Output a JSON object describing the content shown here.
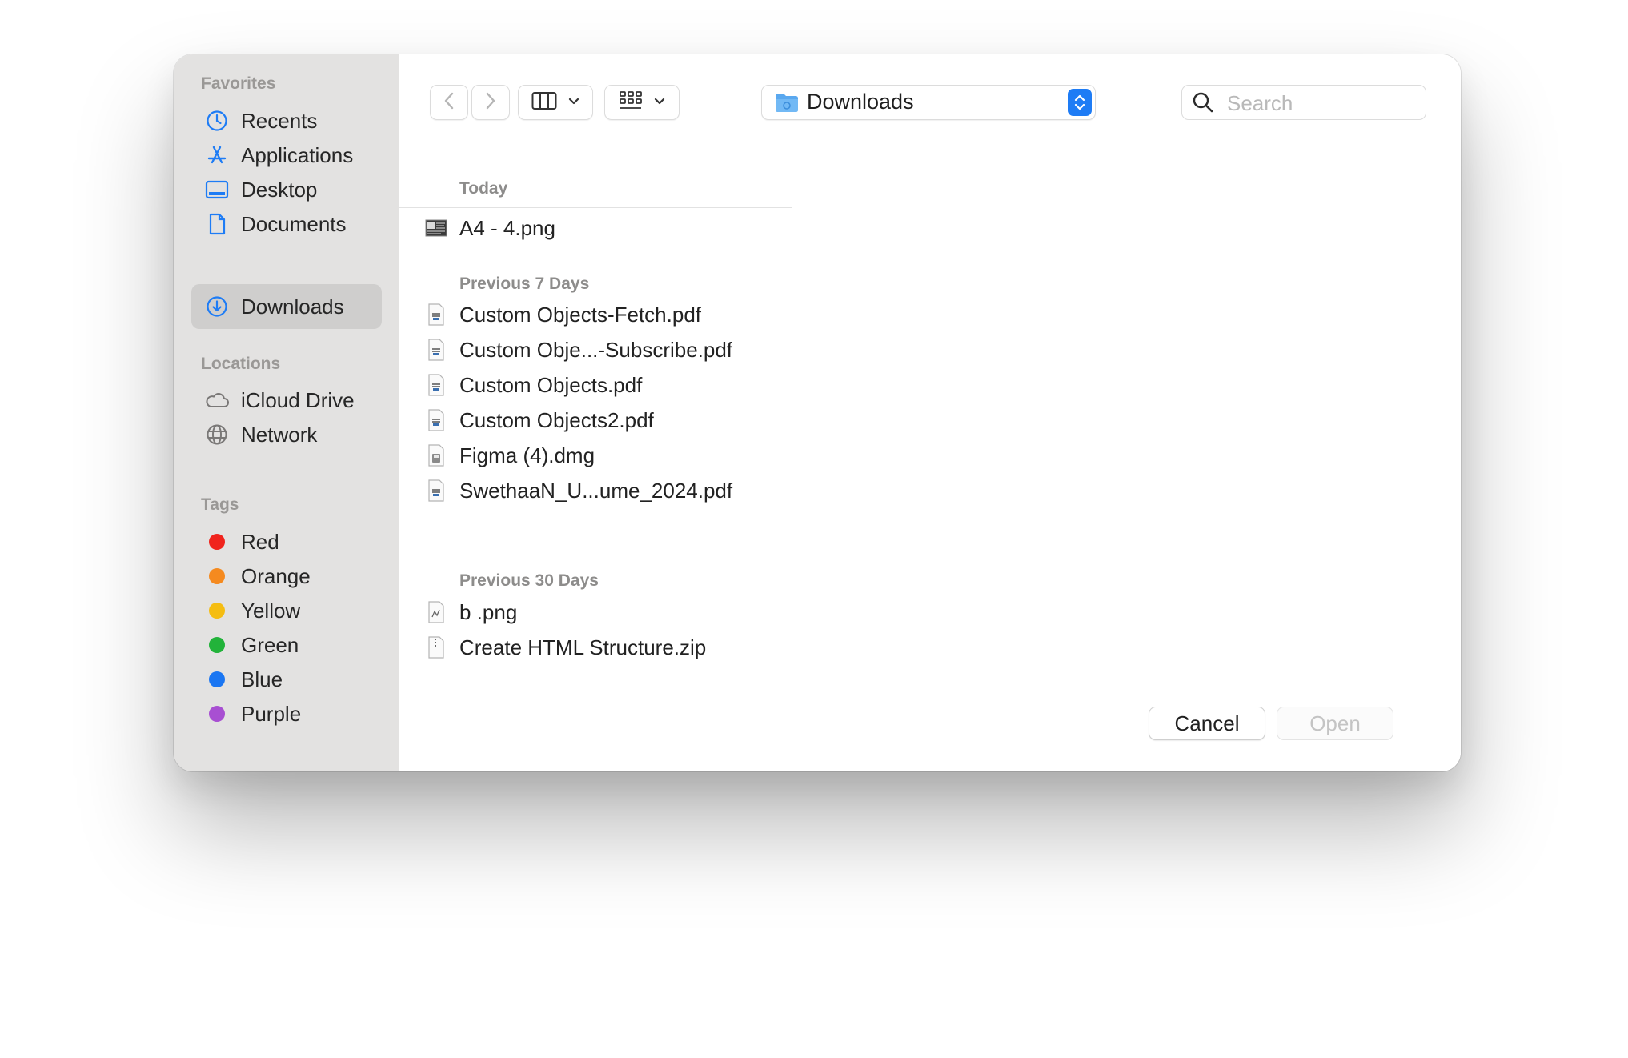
{
  "sidebar": {
    "favorites_header": "Favorites",
    "favorites": [
      {
        "label": "Recents",
        "icon": "clock-icon"
      },
      {
        "label": "Applications",
        "icon": "app-store-icon"
      },
      {
        "label": "Desktop",
        "icon": "desktop-icon"
      },
      {
        "label": "Documents",
        "icon": "document-icon"
      },
      {
        "label": "Downloads",
        "icon": "download-icon",
        "selected": true
      }
    ],
    "locations_header": "Locations",
    "locations": [
      {
        "label": "iCloud Drive",
        "icon": "cloud-icon"
      },
      {
        "label": "Network",
        "icon": "globe-icon"
      }
    ],
    "tags_header": "Tags",
    "tags": [
      {
        "label": "Red",
        "color": "#f0241d"
      },
      {
        "label": "Orange",
        "color": "#f58a1f"
      },
      {
        "label": "Yellow",
        "color": "#f5bd12"
      },
      {
        "label": "Green",
        "color": "#22b33a"
      },
      {
        "label": "Blue",
        "color": "#1a76f2"
      },
      {
        "label": "Purple",
        "color": "#a84fd2"
      }
    ],
    "accent_color": "#1e7cf5"
  },
  "toolbar": {
    "location": "Downloads",
    "search_placeholder": "Search"
  },
  "files": {
    "groups": [
      {
        "header": "Today",
        "items": [
          {
            "name": "A4 - 4.png",
            "icon": "image-thumbnail-icon"
          }
        ]
      },
      {
        "header": "Previous 7 Days",
        "items": [
          {
            "name": "Custom Objects-Fetch.pdf",
            "icon": "pdf-file-icon"
          },
          {
            "name": "Custom Obje...-Subscribe.pdf",
            "icon": "pdf-file-icon"
          },
          {
            "name": "Custom Objects.pdf",
            "icon": "pdf-file-icon"
          },
          {
            "name": "Custom Objects2.pdf",
            "icon": "pdf-file-icon"
          },
          {
            "name": "Figma (4).dmg",
            "icon": "disk-image-icon"
          },
          {
            "name": "SwethaaN_U...ume_2024.pdf",
            "icon": "pdf-file-icon"
          }
        ]
      },
      {
        "header": "Previous 30 Days",
        "items": [
          {
            "name": "b .png",
            "icon": "image-file-icon"
          },
          {
            "name": "Create HTML Structure.zip",
            "icon": "zip-file-icon"
          }
        ]
      }
    ]
  },
  "buttons": {
    "cancel": "Cancel",
    "open": "Open"
  }
}
